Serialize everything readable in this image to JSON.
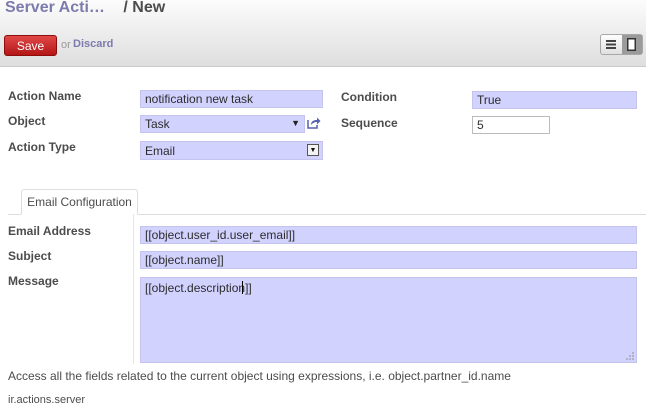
{
  "breadcrumb": {
    "parent": "Server Acti…",
    "separator": "/",
    "current": "New"
  },
  "toolbar": {
    "save_label": "Save",
    "or_label": "or",
    "discard_label": "Discard"
  },
  "view_switcher": {
    "list_icon": "list-icon",
    "form_icon": "form-icon",
    "active": "form"
  },
  "form": {
    "action_name": {
      "label": "Action Name",
      "value": "notification new task"
    },
    "object": {
      "label": "Object",
      "value": "Task"
    },
    "action_type": {
      "label": "Action Type",
      "value": "Email"
    },
    "condition": {
      "label": "Condition",
      "value": "True"
    },
    "sequence": {
      "label": "Sequence",
      "value": "5"
    }
  },
  "tabs": [
    {
      "label": "Email Configuration"
    }
  ],
  "email": {
    "address": {
      "label": "Email Address",
      "value": "[[object.user_id.user_email]]"
    },
    "subject": {
      "label": "Subject",
      "value": "[[object.name]]"
    },
    "message": {
      "label": "Message",
      "value_before_caret": "[[object.description",
      "value_after_caret": "]]"
    }
  },
  "help_text": "Access all the fields related to the current object using expressions, i.e. object.partner_id.name",
  "model_name": "ir.actions.server",
  "colors": {
    "accent": "#7c7bad",
    "save": "#c81e1e",
    "required_field": "#d2d2ff"
  }
}
